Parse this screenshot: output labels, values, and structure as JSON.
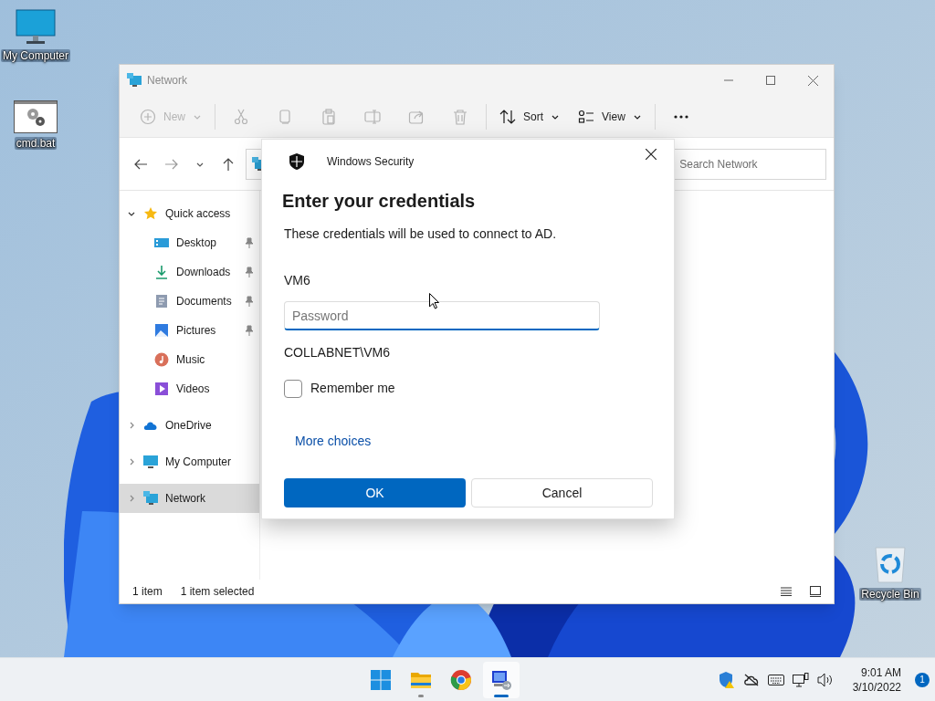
{
  "desktop": {
    "icons": [
      {
        "kind": "computer",
        "label": "My Computer"
      },
      {
        "kind": "script",
        "label": "cmd.bat"
      },
      {
        "kind": "recycle",
        "label": "Recycle Bin"
      }
    ]
  },
  "explorer": {
    "title": "Network",
    "toolbar": [
      {
        "kind": "new",
        "label": "New",
        "disabled": true
      },
      {
        "kind": "cut",
        "disabled": true
      },
      {
        "kind": "copy",
        "disabled": true
      },
      {
        "kind": "paste",
        "disabled": true
      },
      {
        "kind": "rename",
        "disabled": true
      },
      {
        "kind": "share",
        "disabled": true
      },
      {
        "kind": "delete",
        "disabled": true
      },
      {
        "kind": "sort",
        "label": "Sort",
        "disabled": false
      },
      {
        "kind": "view",
        "label": "View",
        "disabled": false
      },
      {
        "kind": "more",
        "disabled": false
      }
    ],
    "search": {
      "placeholder": "Search Network"
    },
    "nav": [
      {
        "kind": "star",
        "label": "Quick access",
        "expanded": true,
        "selected": false,
        "children": [
          {
            "kind": "desktop",
            "label": "Desktop",
            "pinned": true,
            "selected": false
          },
          {
            "kind": "download",
            "label": "Downloads",
            "pinned": true,
            "selected": false
          },
          {
            "kind": "document",
            "label": "Documents",
            "pinned": true,
            "selected": false
          },
          {
            "kind": "pictures",
            "label": "Pictures",
            "pinned": true,
            "selected": false
          },
          {
            "kind": "music",
            "label": "Music",
            "pinned": false,
            "selected": false
          },
          {
            "kind": "videos",
            "label": "Videos",
            "pinned": false,
            "selected": false
          }
        ]
      },
      {
        "kind": "cloud",
        "label": "OneDrive",
        "expanded": false,
        "selected": false
      },
      {
        "kind": "computer",
        "label": "My Computer",
        "expanded": false,
        "selected": false
      },
      {
        "kind": "network",
        "label": "Network",
        "expanded": false,
        "selected": true
      }
    ],
    "status_bar": {
      "items": "1 item",
      "selection": "1 item selected"
    }
  },
  "dialog": {
    "header": "Windows Security",
    "title": "Enter your credentials",
    "message": "These credentials will be used to connect to AD.",
    "username": "VM6",
    "password": {
      "placeholder": "Password"
    },
    "domain": "COLLABNET\\VM6",
    "remember": {
      "label": "Remember me",
      "checked": false
    },
    "link": "More choices",
    "buttons": [
      {
        "label": "OK",
        "primary": true
      },
      {
        "label": "Cancel",
        "primary": false
      }
    ]
  },
  "taskbar": {
    "apps": [
      {
        "kind": "start",
        "running": false,
        "active": false
      },
      {
        "kind": "folder",
        "running": true,
        "active": false
      },
      {
        "kind": "browser",
        "running": false,
        "active": false
      },
      {
        "kind": "remote",
        "running": true,
        "active": true
      }
    ],
    "time": "9:01 AM",
    "date": "3/10/2022",
    "notifications": "1"
  }
}
